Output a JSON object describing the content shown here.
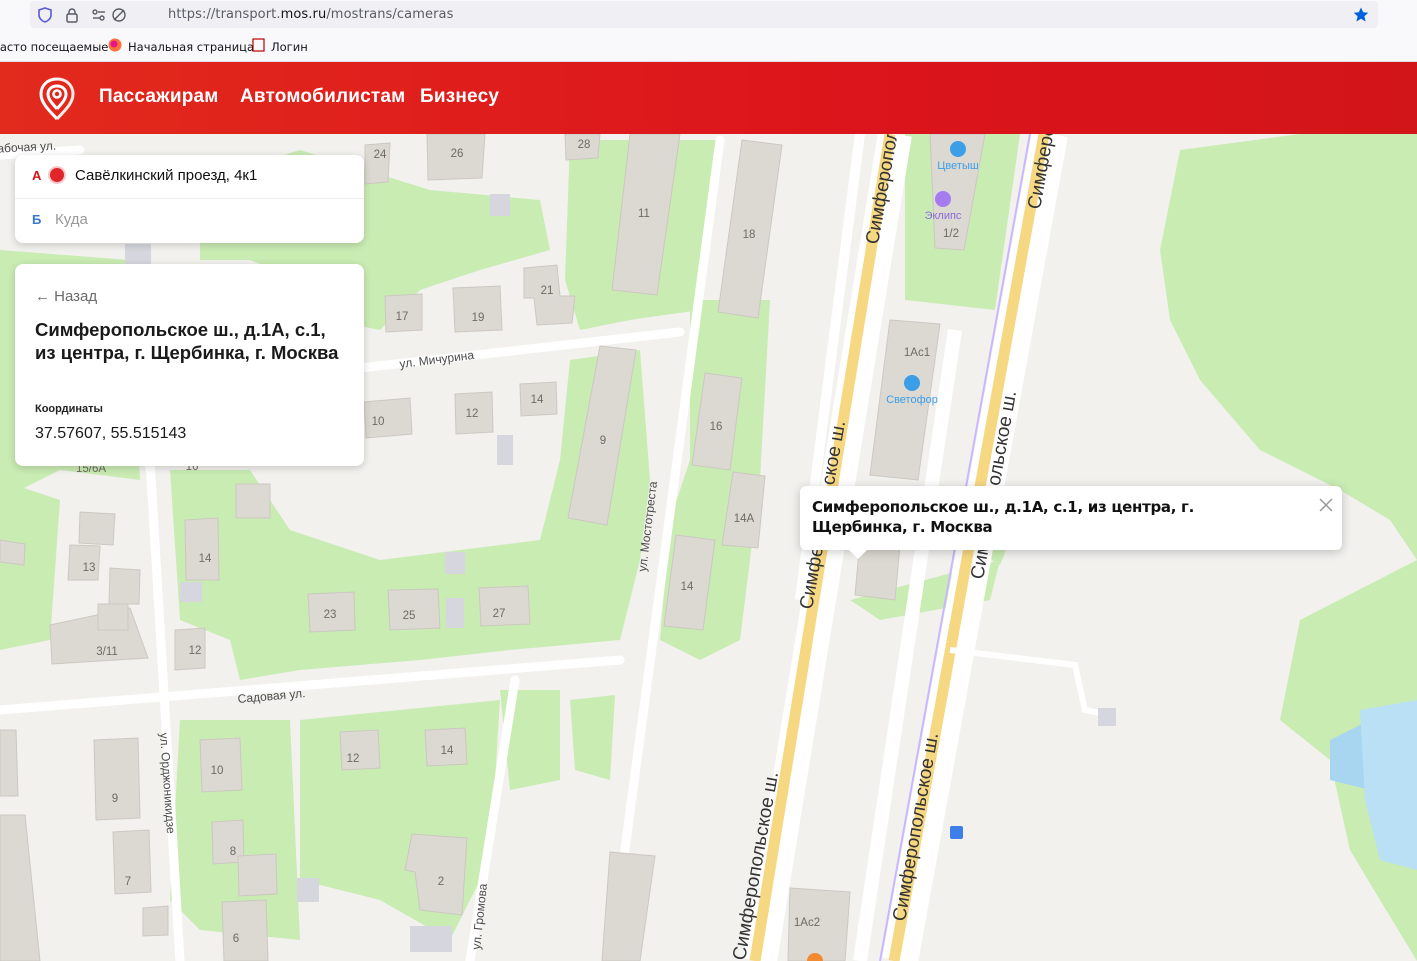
{
  "browser": {
    "url_prefix": "https://transport.",
    "url_domain": "mos.ru",
    "url_path": "/mostrans/cameras",
    "bookmarks": [
      "Часто посещаемые",
      "Начальная страница",
      "Логин"
    ]
  },
  "header": {
    "nav": [
      "Пассажирам",
      "Автомобилистам",
      "Бизнесу"
    ],
    "accent_color": "#dc141b"
  },
  "route": {
    "from_letter": "А",
    "from_value": "Савёлкинский проезд, 4к1",
    "to_letter": "Б",
    "to_placeholder": "Куда"
  },
  "info": {
    "back_label": "← Назад",
    "title": "Симферопольское ш., д.1А, с.1, из центра, г. Щербинка, г. Москва",
    "coords_label": "Координаты",
    "coords_value": "37.57607, 55.515143"
  },
  "balloon": {
    "text": "Симферопольское ш., д.1А, с.1, из центра, г. Щербинка, г. Москва"
  },
  "map": {
    "streets": [
      "ул. Мичурина",
      "ул. Мостотреста",
      "Садовая ул.",
      "ул. Орджоникидзе",
      "ул. Громова",
      "Симферопольское ш.",
      "Симферопольское ш.",
      "Симферопольское ш.",
      "Симферопольское ш.",
      "Симферопольское ш.",
      "Симферопольское ш.",
      "Рабочая ул."
    ],
    "pois": [
      "Цветыш",
      "Эклипс",
      "Светофор"
    ],
    "house_numbers": [
      "24",
      "26",
      "28",
      "11",
      "18",
      "1/2",
      "21",
      "17",
      "19",
      "1Ас1",
      "14",
      "10",
      "12",
      "9",
      "16",
      "15/6А",
      "16",
      "14А",
      "13",
      "14",
      "3/11",
      "23",
      "25",
      "27",
      "14",
      "12",
      "9",
      "12",
      "14",
      "10",
      "8",
      "7",
      "2",
      "6",
      "1Ас2"
    ]
  }
}
